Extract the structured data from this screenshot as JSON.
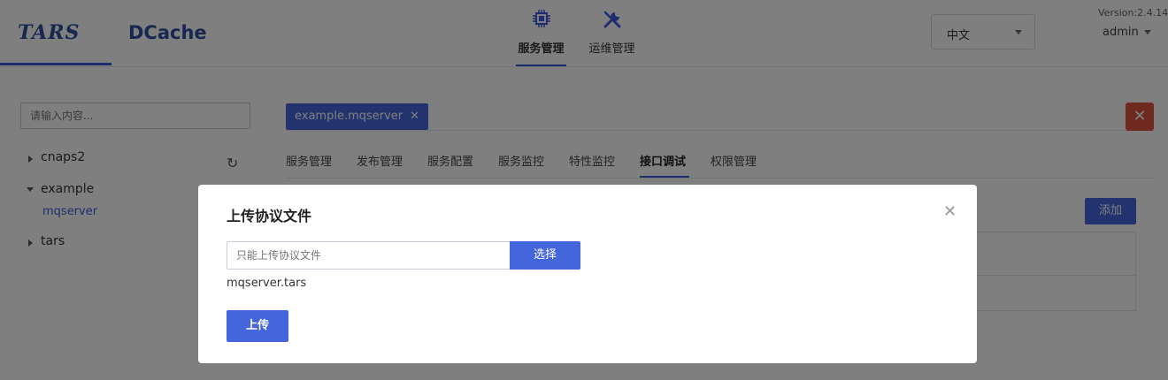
{
  "header": {
    "logo_tars": "TARS",
    "logo_dcache": "DCache",
    "nav": [
      {
        "label": "服务管理",
        "icon": "chip-icon",
        "active": true
      },
      {
        "label": "运维管理",
        "icon": "tools-icon",
        "active": false
      }
    ],
    "language": "中文",
    "version": "Version:2.4.14",
    "user": "admin"
  },
  "sidebar": {
    "search_placeholder": "请输入内容...",
    "tree": [
      {
        "label": "cnaps2",
        "expanded": false
      },
      {
        "label": "example",
        "expanded": true,
        "children": [
          "mqserver"
        ]
      },
      {
        "label": "tars",
        "expanded": false
      }
    ]
  },
  "main": {
    "open_tab": "example.mqserver",
    "tabs": [
      "服务管理",
      "发布管理",
      "服务配置",
      "服务监控",
      "特性监控",
      "接口调试",
      "权限管理"
    ],
    "active_tab": "接口调试",
    "add_label": "添加"
  },
  "modal": {
    "title": "上传协议文件",
    "file_placeholder": "只能上传协议文件",
    "choose_label": "选择",
    "file_name": "mqserver.tars",
    "upload_label": "上传"
  },
  "colors": {
    "primary": "#4466dd",
    "danger": "#e0533e"
  }
}
